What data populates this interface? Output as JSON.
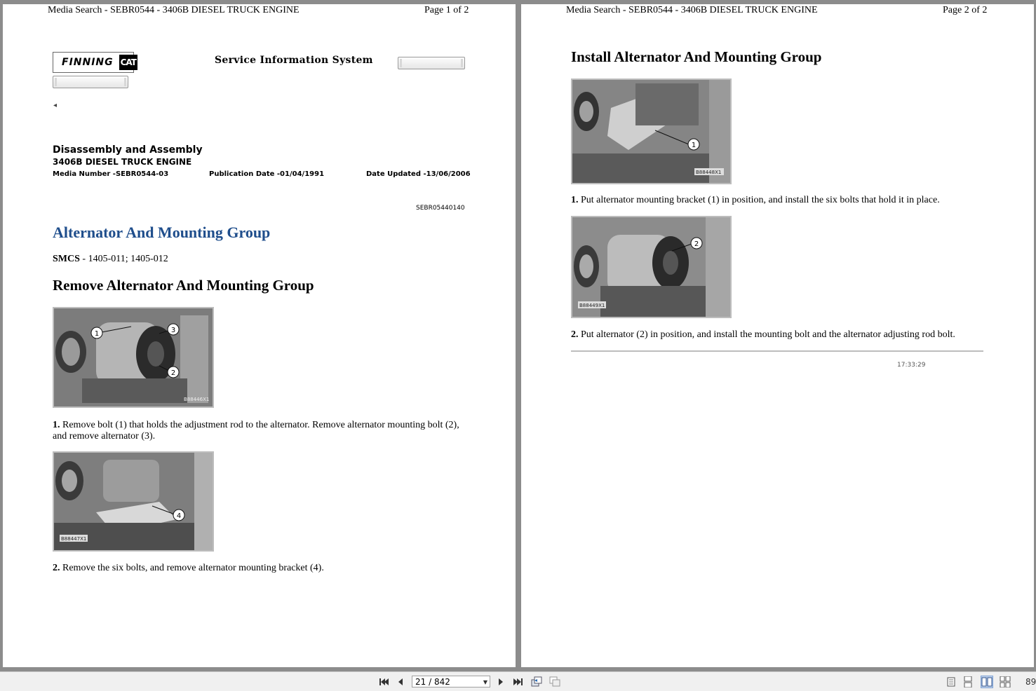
{
  "page1": {
    "header_left": "Media Search - SEBR0544 - 3406B DIESEL TRUCK ENGINE",
    "header_right": "Page 1 of 2",
    "logo_finning": "FINNING",
    "logo_cat": "CAT",
    "sis_title": "Service Information System",
    "doc_title": "Disassembly and Assembly",
    "doc_subtitle": "3406B DIESEL TRUCK ENGINE",
    "media_number": "Media Number -SEBR0544-03",
    "publication_date": "Publication Date -01/04/1991",
    "date_updated": "Date Updated -13/06/2006",
    "ref_number": "SEBR05440140",
    "section_title": "Alternator And Mounting Group",
    "smcs_label": "SMCS",
    "smcs_value": " - 1405-011; 1405-012",
    "remove_title": "Remove Alternator And Mounting Group",
    "img1_tag": "B88446X1",
    "img1_callouts": [
      "1",
      "3",
      "2"
    ],
    "step1_num": "1.",
    "step1_text": " Remove bolt (1) that holds the adjustment rod to the alternator. Remove alternator mounting bolt (2), and remove alternator (3).",
    "img2_tag": "B88447X1",
    "img2_callouts": [
      "4"
    ],
    "step2_num": "2.",
    "step2_text": " Remove the six bolts, and remove alternator mounting bracket (4)."
  },
  "page2": {
    "header_left": "Media Search - SEBR0544 - 3406B DIESEL TRUCK ENGINE",
    "header_right": "Page 2 of 2",
    "install_title": "Install Alternator And Mounting Group",
    "img3_tag": "B88448X1",
    "img3_callouts": [
      "1"
    ],
    "step1_num": "1.",
    "step1_text": " Put alternator mounting bracket (1) in position, and install the six bolts that hold it in place.",
    "img4_tag": "B88449X1",
    "img4_callouts": [
      "2"
    ],
    "step2_num": "2.",
    "step2_text": " Put alternator (2) in position, and install the mounting bolt and the alternator adjusting rod bolt.",
    "timestamp": "17:33:29"
  },
  "toolbar": {
    "page_indicator": "21 / 842",
    "zoom": "89",
    "icons": [
      "first-page-icon",
      "previous-page-icon",
      "next-page-icon",
      "last-page-icon",
      "back-view-icon",
      "forward-view-icon",
      "single-page-view-icon",
      "continuous-view-icon",
      "two-page-view-icon",
      "two-page-continuous-view-icon"
    ]
  }
}
